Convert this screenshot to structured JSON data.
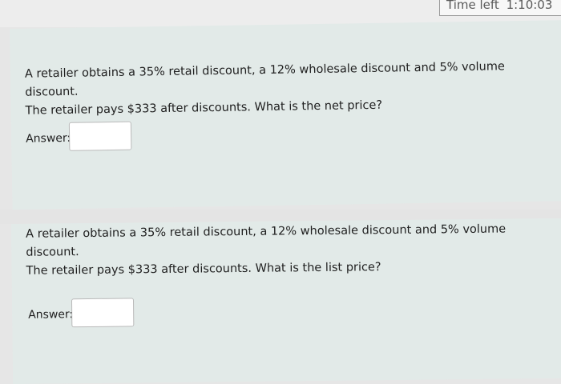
{
  "timer": {
    "label": "Time left",
    "value": "1:10:03"
  },
  "questions": [
    {
      "text_line1": "A retailer obtains a 35% retail discount, a 12% wholesale discount and 5% volume discount.",
      "text_line2": "The retailer pays $333 after discounts. What is the net price?",
      "answer_label": "Answer:",
      "answer_value": ""
    },
    {
      "text_line1": "A retailer obtains a 35% retail discount, a 12% wholesale discount and 5% volume discount.",
      "text_line2": "The retailer pays $333 after discounts. What is the list price?",
      "answer_label": "Answer:",
      "answer_value": ""
    }
  ]
}
